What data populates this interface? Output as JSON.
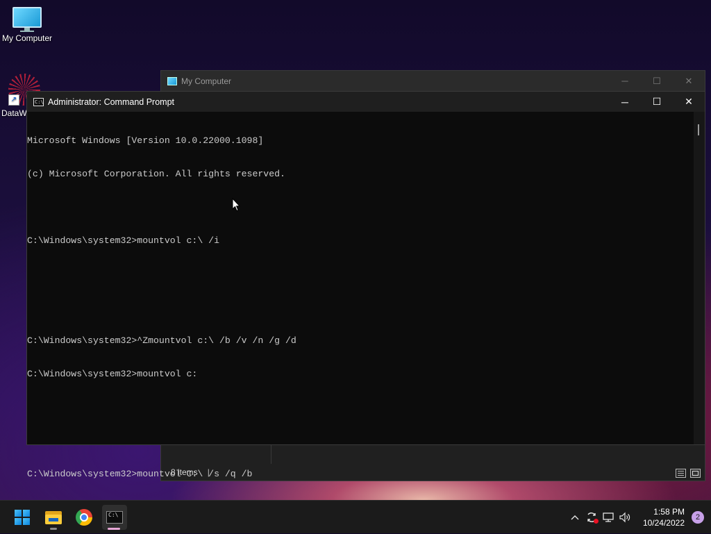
{
  "desktop": {
    "icons": [
      {
        "label": "My Computer",
        "icon": "monitor-icon"
      },
      {
        "label": "DataW",
        "icon": "datawrapper-shortcut-icon"
      }
    ]
  },
  "explorer_window": {
    "title": "My Computer",
    "controls": {
      "minimize": "─",
      "maximize": "☐",
      "close": "✕"
    },
    "status_text": "8 items",
    "status_separator": "|"
  },
  "cmd_window": {
    "title": "Administrator: Command Prompt",
    "icon_text": "C:\\",
    "controls": {
      "minimize": "─",
      "maximize": "☐",
      "close": "✕"
    },
    "lines": [
      "Microsoft Windows [Version 10.0.22000.1098]",
      "(c) Microsoft Corporation. All rights reserved.",
      "",
      "C:\\Windows\\system32>mountvol c:\\ /i",
      "",
      "",
      "C:\\Windows\\system32>^Zmountvol c:\\ /b /v /n /g /d",
      "C:\\Windows\\system32>mountvol c:",
      "",
      "",
      "C:\\Windows\\system32>mountvol C:\\ /s /q /b"
    ]
  },
  "taskbar": {
    "apps": [
      {
        "name": "start",
        "icon": "windows-logo-icon"
      },
      {
        "name": "file-explorer",
        "icon": "folder-icon"
      },
      {
        "name": "chrome",
        "icon": "chrome-icon"
      },
      {
        "name": "command-prompt",
        "icon": "terminal-icon",
        "active": true
      }
    ],
    "tray": {
      "chevron": "^",
      "time": "1:58 PM",
      "date": "10/24/2022",
      "notification_count": "2"
    }
  }
}
